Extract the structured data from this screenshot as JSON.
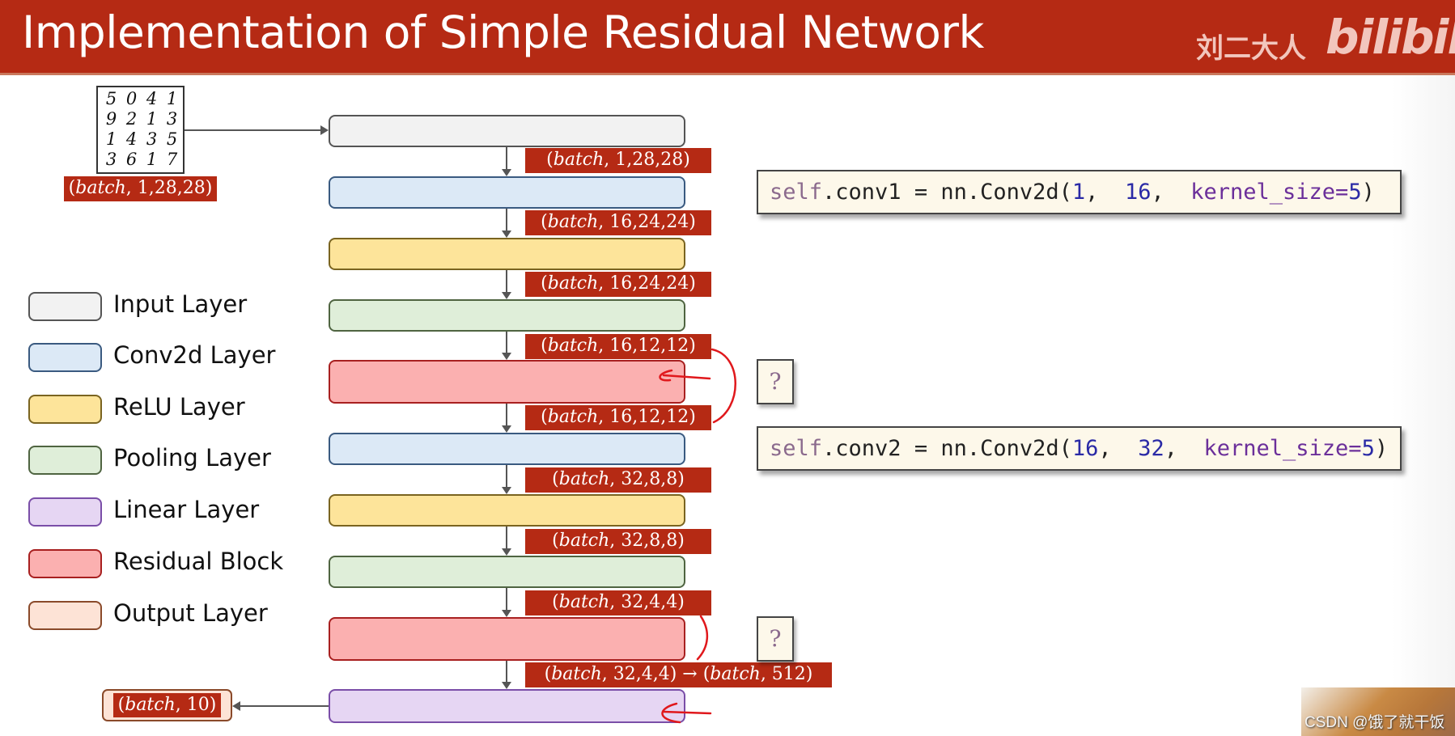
{
  "header": {
    "title": "Implementation of Simple Residual Network",
    "brand_cn": "刘二大人",
    "brand_logo": "bilibili",
    "colors": {
      "background": "#b52a14",
      "brand_text": "#f2c6bd"
    }
  },
  "input_image": {
    "digits": [
      "5",
      "0",
      "4",
      "1",
      "9",
      "2",
      "1",
      "3",
      "1",
      "4",
      "3",
      "5",
      "3",
      "6",
      "1",
      "7"
    ],
    "shape_label": {
      "var": "batch",
      "dims": ", 1,28,28)"
    }
  },
  "layers": [
    {
      "type": "input",
      "fill": "#f2f2f2",
      "border": "#555555"
    },
    {
      "type": "conv2d",
      "fill": "#dce9f6",
      "border": "#3a5a80"
    },
    {
      "type": "relu",
      "fill": "#fde49a",
      "border": "#7a6420"
    },
    {
      "type": "pooling",
      "fill": "#dfeed9",
      "border": "#4f6441"
    },
    {
      "type": "residual",
      "fill": "#fbb0b0",
      "border": "#a82020"
    },
    {
      "type": "conv2d",
      "fill": "#dce9f6",
      "border": "#3a5a80"
    },
    {
      "type": "relu",
      "fill": "#fde49a",
      "border": "#7a6420"
    },
    {
      "type": "pooling",
      "fill": "#dfeed9",
      "border": "#4f6441"
    },
    {
      "type": "residual",
      "fill": "#fbb0b0",
      "border": "#a82020"
    },
    {
      "type": "linear",
      "fill": "#e6d6f3",
      "border": "#7a4ea8"
    }
  ],
  "shape_labels": [
    {
      "open": "(",
      "var": "batch",
      "dims": ", 1,28,28)"
    },
    {
      "open": "(",
      "var": "batch",
      "dims": ", 16,24,24)"
    },
    {
      "open": "(",
      "var": "batch",
      "dims": ", 16,24,24)"
    },
    {
      "open": "(",
      "var": "batch",
      "dims": ", 16,12,12)"
    },
    {
      "open": "(",
      "var": "batch",
      "dims": ", 16,12,12)"
    },
    {
      "open": "(",
      "var": "batch",
      "dims": ", 32,8,8)"
    },
    {
      "open": "(",
      "var": "batch",
      "dims": ", 32,8,8)"
    },
    {
      "open": "(",
      "var": "batch",
      "dims": ", 32,4,4)"
    },
    {
      "open": "(",
      "var": "batch",
      "dims": ", 32,4,4) → (",
      "var2": "batch",
      "dims2": ", 512)"
    }
  ],
  "output": {
    "open": "(",
    "var": "batch",
    "dims": ", 10)",
    "fill": "#fde3d6",
    "border": "#8a4a2a"
  },
  "legend": [
    {
      "label": "Input Layer",
      "fill": "#f2f2f2",
      "border": "#555555"
    },
    {
      "label": "Conv2d Layer",
      "fill": "#dce9f6",
      "border": "#3a5a80"
    },
    {
      "label": "ReLU Layer",
      "fill": "#fde49a",
      "border": "#7a6420"
    },
    {
      "label": "Pooling Layer",
      "fill": "#dfeed9",
      "border": "#4f6441"
    },
    {
      "label": "Linear Layer",
      "fill": "#e6d6f3",
      "border": "#7a4ea8"
    },
    {
      "label": "Residual Block",
      "fill": "#fbb0b0",
      "border": "#a82020"
    },
    {
      "label": "Output Layer",
      "fill": "#fde3d6",
      "border": "#8a4a2a"
    }
  ],
  "code": [
    {
      "self": "self",
      "rest": ".conv1 = nn.Conv2d(",
      "a1": "1",
      "sep1": ",  ",
      "a2": "16",
      "sep2": ",  ",
      "kw": "kernel_size=",
      "a3": "5",
      "close": ")"
    },
    {
      "self": "self",
      "rest": ".conv2 = nn.Conv2d(",
      "a1": "16",
      "sep1": ",  ",
      "a2": "32",
      "sep2": ",  ",
      "kw": "kernel_size=",
      "a3": "5",
      "close": ")"
    }
  ],
  "question_marks": [
    "?",
    "?"
  ],
  "annotation_color": "#e0181c",
  "watermark": "CSDN @饿了就干饭"
}
